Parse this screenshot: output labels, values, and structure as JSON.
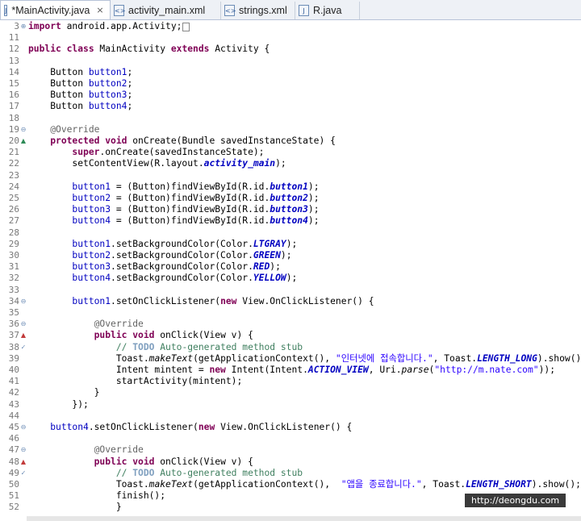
{
  "tabs": [
    {
      "label": "*MainActivity.java",
      "icon": "java-file-icon",
      "active": true
    },
    {
      "label": "activity_main.xml",
      "icon": "xml-file-icon",
      "active": false
    },
    {
      "label": "strings.xml",
      "icon": "xml-file-icon",
      "active": false
    },
    {
      "label": "R.java",
      "icon": "java-file-icon",
      "active": false
    }
  ],
  "tab_close": "×",
  "lines": [
    {
      "n": "3",
      "mark": "fold-plus",
      "html": "<span class=\"kw\">import</span> android.app.Activity;<span class=\"caret\"></span>"
    },
    {
      "n": "11",
      "html": ""
    },
    {
      "n": "12",
      "html": "<span class=\"kw\">public class</span> MainActivity <span class=\"kw\">extends</span> Activity {"
    },
    {
      "n": "13",
      "html": ""
    },
    {
      "n": "14",
      "html": "    Button <span class=\"fld\">button1</span>;"
    },
    {
      "n": "15",
      "html": "    Button <span class=\"fld\">button2</span>;"
    },
    {
      "n": "16",
      "html": "    Button <span class=\"fld\">button3</span>;"
    },
    {
      "n": "17",
      "html": "    Button <span class=\"fld\">button4</span>;"
    },
    {
      "n": "18",
      "html": ""
    },
    {
      "n": "19",
      "mark": "fold-minus",
      "html": "    <span class=\"ann\">@Override</span>"
    },
    {
      "n": "20",
      "mark": "override",
      "html": "    <span class=\"kw\">protected void</span> onCreate(Bundle savedInstanceState) {"
    },
    {
      "n": "21",
      "html": "        <span class=\"kw\">super</span>.onCreate(savedInstanceState);"
    },
    {
      "n": "22",
      "html": "        setContentView(R.layout.<span class=\"sfld\">activity_main</span>);"
    },
    {
      "n": "23",
      "html": ""
    },
    {
      "n": "24",
      "html": "        <span class=\"fld\">button1</span> = (Button)findViewById(R.id.<span class=\"sfld\">button1</span>);"
    },
    {
      "n": "25",
      "html": "        <span class=\"fld\">button2</span> = (Button)findViewById(R.id.<span class=\"sfld\">button2</span>);"
    },
    {
      "n": "26",
      "html": "        <span class=\"fld\">button3</span> = (Button)findViewById(R.id.<span class=\"sfld\">button3</span>);"
    },
    {
      "n": "27",
      "html": "        <span class=\"fld\">button4</span> = (Button)findViewById(R.id.<span class=\"sfld\">button4</span>);"
    },
    {
      "n": "28",
      "html": ""
    },
    {
      "n": "29",
      "html": "        <span class=\"fld\">button1</span>.setBackgroundColor(Color.<span class=\"sfld\">LTGRAY</span>);"
    },
    {
      "n": "30",
      "html": "        <span class=\"fld\">button2</span>.setBackgroundColor(Color.<span class=\"sfld\">GREEN</span>);"
    },
    {
      "n": "31",
      "html": "        <span class=\"fld\">button3</span>.setBackgroundColor(Color.<span class=\"sfld\">RED</span>);"
    },
    {
      "n": "32",
      "html": "        <span class=\"fld\">button4</span>.setBackgroundColor(Color.<span class=\"sfld\">YELLOW</span>);"
    },
    {
      "n": "33",
      "html": ""
    },
    {
      "n": "34",
      "mark": "fold-minus",
      "html": "        <span class=\"fld\">button1</span>.setOnClickListener(<span class=\"kw\">new</span> View.OnClickListener() {"
    },
    {
      "n": "35",
      "html": ""
    },
    {
      "n": "36",
      "mark": "fold-minus",
      "html": "            <span class=\"ann\">@Override</span>"
    },
    {
      "n": "37",
      "mark": "implement",
      "html": "            <span class=\"kw\">public void</span> onClick(View v) {"
    },
    {
      "n": "38",
      "mark": "task",
      "html": "                <span class=\"cmt\">// </span><span class=\"todo\">TODO</span><span class=\"cmt\"> Auto-generated method stub</span>"
    },
    {
      "n": "39",
      "html": "                Toast.<span class=\"sm\">makeText</span>(getApplicationContext(), <span class=\"str\">\"인터넷에 접속합니다.\"</span>, Toast.<span class=\"sfld\">LENGTH_LONG</span>).show();"
    },
    {
      "n": "40",
      "html": "                Intent mintent = <span class=\"kw\">new</span> Intent(Intent.<span class=\"sfld\">ACTION_VIEW</span>, Uri.<span class=\"sm\">parse</span>(<span class=\"str\">\"http://m.nate.com\"</span>));"
    },
    {
      "n": "41",
      "html": "                startActivity(mintent);"
    },
    {
      "n": "42",
      "html": "            }"
    },
    {
      "n": "43",
      "html": "        });"
    },
    {
      "n": "44",
      "html": ""
    },
    {
      "n": "45",
      "mark": "fold-minus",
      "html": "    <span class=\"fld\">button4</span>.setOnClickListener(<span class=\"kw\">new</span> View.OnClickListener() {"
    },
    {
      "n": "46",
      "html": ""
    },
    {
      "n": "47",
      "mark": "fold-minus",
      "html": "            <span class=\"ann\">@Override</span>"
    },
    {
      "n": "48",
      "mark": "implement",
      "html": "            <span class=\"kw\">public void</span> onClick(View v) {"
    },
    {
      "n": "49",
      "mark": "task",
      "html": "                <span class=\"cmt\">// </span><span class=\"todo\">TODO</span><span class=\"cmt\"> Auto-generated method stub</span>"
    },
    {
      "n": "50",
      "html": "                Toast.<span class=\"sm\">makeText</span>(getApplicationContext(),  <span class=\"str\">\"앱을 종료합니다.\"</span>, Toast.<span class=\"sfld\">LENGTH_SHORT</span>).show();"
    },
    {
      "n": "51",
      "html": "                finish();"
    },
    {
      "n": "52",
      "html": "                }"
    }
  ],
  "watermark": "http://deongdu.com",
  "colors": {
    "keyword": "#7f0055",
    "field": "#0000c0",
    "string": "#2a00ff",
    "comment": "#3f7f5f",
    "annotation": "#646464"
  }
}
